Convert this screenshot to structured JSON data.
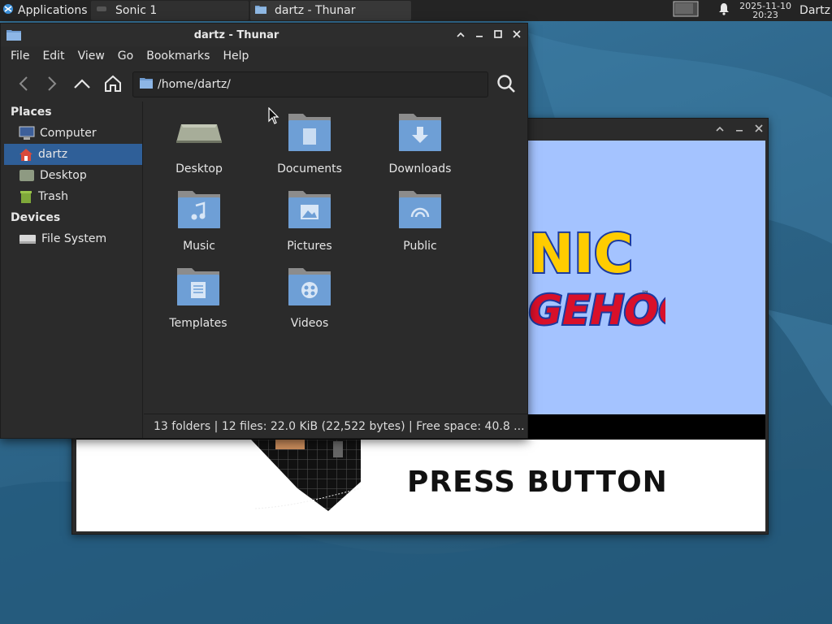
{
  "panel": {
    "applications_label": "Applications",
    "tasks": [
      {
        "label": "Sonic 1",
        "icon": "game-icon"
      },
      {
        "label": "dartz - Thunar",
        "icon": "folder-icon"
      }
    ],
    "clock_date": "2025-11-10",
    "clock_time": "20:23",
    "user": "Dartz"
  },
  "thunar": {
    "title": "dartz - Thunar",
    "menu": [
      "File",
      "Edit",
      "View",
      "Go",
      "Bookmarks",
      "Help"
    ],
    "location": "/home/dartz/",
    "sidebar": {
      "places_heading": "Places",
      "places": [
        {
          "label": "Computer",
          "icon": "computer-icon"
        },
        {
          "label": "dartz",
          "icon": "home-icon",
          "active": true
        },
        {
          "label": "Desktop",
          "icon": "desktop-icon"
        },
        {
          "label": "Trash",
          "icon": "trash-icon"
        }
      ],
      "devices_heading": "Devices",
      "devices": [
        {
          "label": "File System",
          "icon": "drive-icon"
        }
      ]
    },
    "files": [
      {
        "label": "Desktop",
        "icon": "desktop-folder-icon"
      },
      {
        "label": "Documents",
        "icon": "documents-folder-icon"
      },
      {
        "label": "Downloads",
        "icon": "downloads-folder-icon"
      },
      {
        "label": "Music",
        "icon": "music-folder-icon"
      },
      {
        "label": "Pictures",
        "icon": "pictures-folder-icon"
      },
      {
        "label": "Public",
        "icon": "public-folder-icon"
      },
      {
        "label": "Templates",
        "icon": "templates-folder-icon"
      },
      {
        "label": "Videos",
        "icon": "videos-folder-icon"
      }
    ],
    "status": "13 folders  |  12 files: 22.0 KiB (22,522 bytes)  |  Free space: 40.8 ..."
  },
  "sonic": {
    "logo_line1": "NIC",
    "logo_line2": "GEHOG",
    "trademark": "™",
    "press_button": "PRESS BUTTON"
  }
}
